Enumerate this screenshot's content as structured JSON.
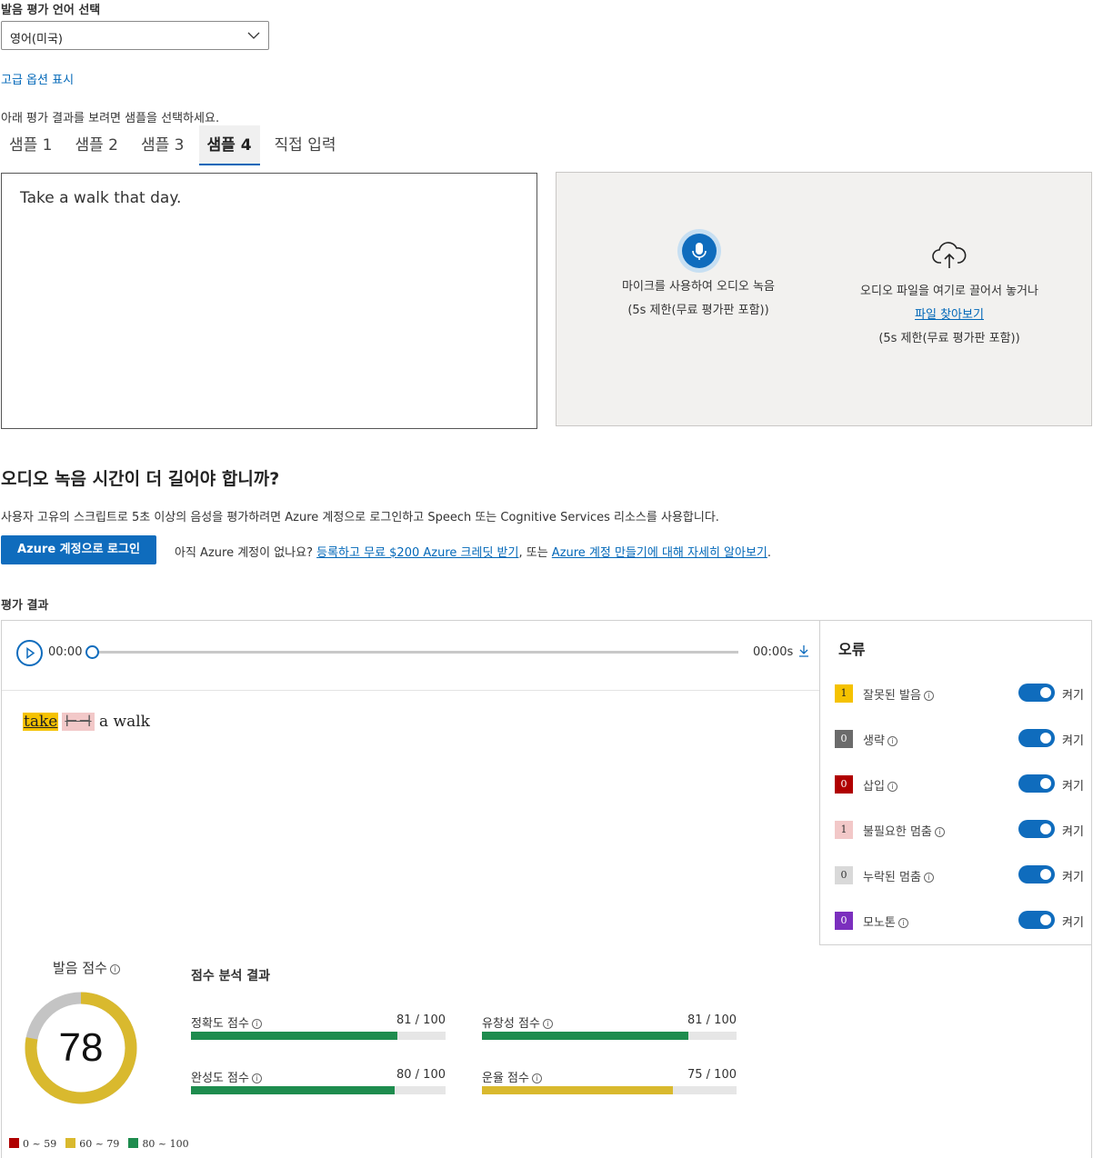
{
  "language": {
    "label": "발음 평가 언어 선택",
    "selected": "영어(미국)"
  },
  "advanced_link": "고급 옵션 표시",
  "sample_hint": "아래 평가 결과를 보려면 샘플을 선택하세요.",
  "tabs": [
    {
      "label": "샘플 1",
      "active": false
    },
    {
      "label": "샘플 2",
      "active": false
    },
    {
      "label": "샘플 3",
      "active": false
    },
    {
      "label": "샘플 4",
      "active": true
    },
    {
      "label": "직접 입력",
      "active": false
    }
  ],
  "reference_text": "Take a walk that day.",
  "upload": {
    "mic_line1": "마이크를 사용하여 오디오 녹음",
    "mic_line2": "(5s 제한(무료 평가판 포함))",
    "file_line1": "오디오 파일을 여기로 끌어서 놓거나",
    "file_link": "파일 찾아보기",
    "file_line3": "(5s 제한(무료 평가판 포함))"
  },
  "azure": {
    "title": "오디오 녹음 시간이 더 길어야 합니까?",
    "desc": "사용자 고유의 스크립트로 5초 이상의 음성을 평가하려면 Azure 계정으로 로그인하고 Speech 또는 Cognitive Services 리소스를 사용합니다.",
    "button": "Azure 계정으로 로그인",
    "note_prefix": "아직 Azure 계정이 없나요?",
    "link1": "등록하고 무료 $200 Azure 크레딧 받기",
    "note_mid": ", 또는",
    "link2": "Azure 계정 만들기에 대해 자세히 알아보기",
    "note_end": "."
  },
  "results": {
    "label": "평가 결과",
    "player": {
      "current": "00:00",
      "duration": "00:00s",
      "progress": 0
    },
    "words": {
      "w1": "take",
      "w2": "",
      "w3": "a walk"
    },
    "errors_title": "오류",
    "errors": [
      {
        "name": "잘못된 발음",
        "count": "1",
        "bg": "#f5c200",
        "fg": "#222",
        "toggle": "켜기"
      },
      {
        "name": "생략",
        "count": "0",
        "bg": "#6b6b6b",
        "fg": "#fff",
        "toggle": "켜기"
      },
      {
        "name": "삽입",
        "count": "0",
        "bg": "#b00000",
        "fg": "#fff",
        "toggle": "켜기"
      },
      {
        "name": "불필요한 멈춤",
        "count": "1",
        "bg": "#f2c8c8",
        "fg": "#333",
        "toggle": "켜기"
      },
      {
        "name": "누락된 멈춤",
        "count": "0",
        "bg": "#d9d9d9",
        "fg": "#333",
        "toggle": "켜기"
      },
      {
        "name": "모노톤",
        "count": "0",
        "bg": "#7b2fbe",
        "fg": "#fff",
        "toggle": "켜기"
      }
    ],
    "pron_score_label": "발음 점수",
    "pron_score": "78",
    "breakdown_title": "점수 분석 결과",
    "metrics": [
      {
        "name": "정확도 점수",
        "value": "81 / 100",
        "score": 81,
        "color": "#1e8c4e"
      },
      {
        "name": "유창성 점수",
        "value": "81 / 100",
        "score": 81,
        "color": "#1e8c4e"
      },
      {
        "name": "완성도 점수",
        "value": "80 / 100",
        "score": 80,
        "color": "#1e8c4e"
      },
      {
        "name": "운율 점수",
        "value": "75 / 100",
        "score": 75,
        "color": "#d9b92e"
      }
    ],
    "legend": [
      {
        "label": "0 ~ 59",
        "color": "#b00000"
      },
      {
        "label": "60 ~ 79",
        "color": "#d9b92e"
      },
      {
        "label": "80 ~ 100",
        "color": "#1e8c4e"
      }
    ]
  }
}
